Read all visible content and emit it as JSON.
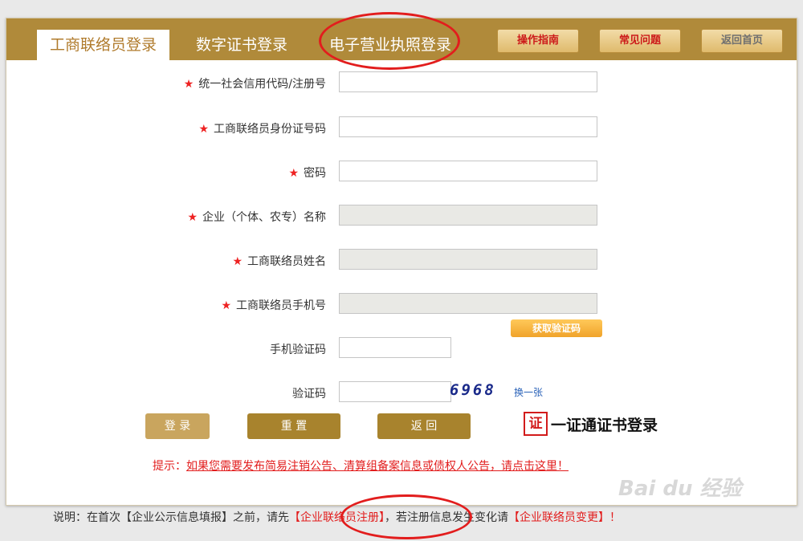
{
  "tabs": [
    {
      "label": "工商联络员登录",
      "active": true
    },
    {
      "label": "数字证书登录",
      "active": false
    },
    {
      "label": "电子营业执照登录",
      "active": false
    }
  ],
  "header_buttons": {
    "guide": "操作指南",
    "faq": "常见问题",
    "home": "返回首页"
  },
  "form": {
    "credit_code": {
      "label": "统一社会信用代码/注册号",
      "required": true,
      "value": "",
      "disabled": false
    },
    "id_number": {
      "label": "工商联络员身份证号码",
      "required": true,
      "value": "",
      "disabled": false
    },
    "password": {
      "label": "密码",
      "required": true,
      "value": "",
      "disabled": false
    },
    "company_name": {
      "label": "企业（个体、农专）名称",
      "required": true,
      "value": "",
      "disabled": true
    },
    "liaison_name": {
      "label": "工商联络员姓名",
      "required": true,
      "value": "",
      "disabled": true
    },
    "liaison_phone": {
      "label": "工商联络员手机号",
      "required": true,
      "value": "",
      "disabled": true
    },
    "sms_code": {
      "label": "手机验证码",
      "required": false,
      "value": ""
    },
    "captcha": {
      "label": "验证码",
      "required": false,
      "value": ""
    }
  },
  "required_mark": "★",
  "get_code_button": "获取验证码",
  "captcha_image_text": "6968",
  "refresh_link": "换一张",
  "buttons": {
    "login": "登 录",
    "reset": "重 置",
    "back": "返 回"
  },
  "cert_login": {
    "icon_char": "证",
    "label": "一证通证书登录"
  },
  "tip": {
    "prefix": "提示：",
    "link": "如果您需要发布简易注销公告、清算组备案信息或债权人公告，请点击这里！"
  },
  "note": {
    "part1": "说明：在首次【企业公示信息填报】之前，请先",
    "link1": "【企业联络员注册】",
    "part2": "，若注册信息发生变化请",
    "link2": "【企业联络员变更】",
    "part3": "！"
  },
  "watermark": "Bai du 经验",
  "colors": {
    "header_bg": "#b08a3a",
    "active_tab_text": "#b07b2c",
    "accent_red": "#e21d1d",
    "button_gold": "#c9a55e",
    "button_dark_gold": "#a8832d"
  }
}
